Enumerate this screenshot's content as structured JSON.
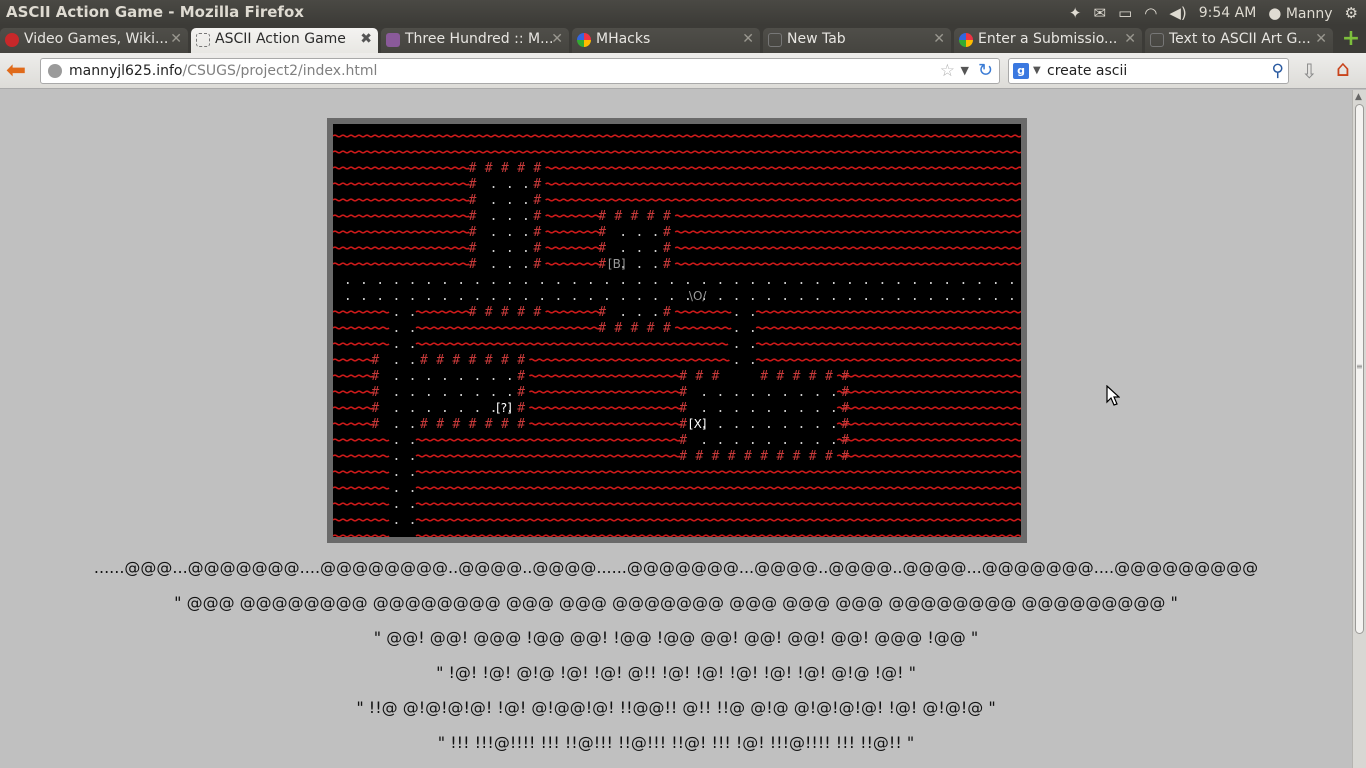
{
  "window": {
    "title": "ASCII Action Game - Mozilla Firefox"
  },
  "tray": {
    "clock": "9:54 AM",
    "user": "Manny",
    "icons": [
      "dropbox-icon",
      "mail-icon",
      "battery-icon",
      "wifi-icon",
      "volume-icon",
      "user-icon",
      "settings-gear-icon"
    ]
  },
  "tabs": [
    {
      "label": "Video Games, Wiki...",
      "active": false,
      "favicon": "#c8282a"
    },
    {
      "label": "ASCII Action Game",
      "active": true,
      "favicon": "#ffffff"
    },
    {
      "label": "Three Hundred :: M...",
      "active": false,
      "favicon": "#8a5a9a"
    },
    {
      "label": "MHacks",
      "active": false,
      "favicon": "#e8a020"
    },
    {
      "label": "New Tab",
      "active": false,
      "favicon": "#4f4e49"
    },
    {
      "label": "Enter a Submissio...",
      "active": false,
      "favicon": "#e8a020"
    },
    {
      "label": "Text to ASCII Art G...",
      "active": false,
      "favicon": "#4f4e49"
    }
  ],
  "navbar": {
    "url_host": "mannyjl625.info",
    "url_path": "/CSUGS/project2/index.html",
    "search_text": "create ascii",
    "search_engine": "g"
  },
  "game": {
    "markers": {
      "b": "[B]",
      "player": "\\O/",
      "q": "[?]",
      "x": "[X]"
    },
    "wall_char": "#",
    "floor_char": ".",
    "lava_color": "#cc1a1a",
    "wall_color": "#c83a3a",
    "floor_color": "#d0d0d0"
  },
  "banner": [
    "......@@@...@@@@@@@....@@@@@@@@..@@@@..@@@@......@@@@@@@...@@@@..@@@@..@@@@...@@@@@@@....@@@@@@@@@",
    "\" @@@ @@@@@@@@ @@@@@@@@ @@@ @@@ @@@@@@@ @@@ @@@ @@@ @@@@@@@@ @@@@@@@@@ \"",
    "\" @@! @@! @@@ !@@ @@! !@@ !@@ @@! @@! @@! @@! @@@ !@@ \"",
    "\" !@! !@! @!@ !@! !@! @!! !@! !@! !@! !@! !@! @!@ !@! \"",
    "\" !!@ @!@!@!@! !@! @!@@!@! !!@@!! @!! !!@ @!@ @!@!@!@! !@! @!@!@ \"",
    "\" !!! !!!@!!!! !!! !!@!!! !!@!!! !!@! !!! !@! !!!@!!!! !!! !!@!! \""
  ]
}
